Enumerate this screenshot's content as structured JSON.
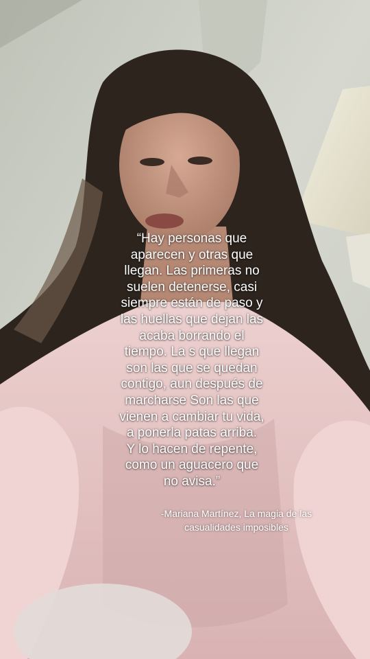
{
  "quote": {
    "lines": [
      "“Hay personas que",
      "aparecen y otras que",
      "llegan. Las primeras no",
      "suelen detenerse, casi",
      "siempre están de paso y",
      "las huellas que dejan las",
      "acaba borrando el",
      "tiempo. La s que llegan",
      "son las que se quedan",
      "contigo, aun después de",
      "marcharse Son las que",
      "vienen a cambiar tu vida,",
      "a ponerla patas arriba.",
      "Y lo hacen de repente,",
      "como un aguacero que",
      "no avisa.”"
    ]
  },
  "attribution": {
    "lines": [
      "-Mariana Martínez, La magia de las",
      "casualidades imposibles"
    ]
  },
  "colors": {
    "wall": "#d3d6cc",
    "hair": "#2a211c",
    "skin": "#c79a85",
    "sweater": "#e8c6c6",
    "lampshade": "#ece8d6",
    "text": "#ffffff"
  }
}
